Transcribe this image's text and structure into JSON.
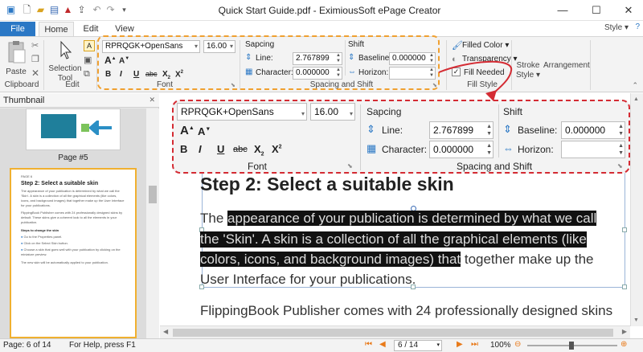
{
  "window": {
    "title": "Quick Start Guide.pdf - EximiousSoft ePage Creator",
    "minimize": "—",
    "maximize": "☐",
    "close": "✕"
  },
  "quick_access": [
    "new-icon",
    "open-icon",
    "save-icon",
    "pdf-icon",
    "export-icon",
    "undo-icon",
    "redo-icon",
    "dropdown-icon"
  ],
  "tabs": {
    "file": "File",
    "home": "Home",
    "edit": "Edit",
    "view": "View",
    "style_menu": "Style ▾"
  },
  "ribbon": {
    "clipboard": {
      "paste": "Paste",
      "label": "Clipboard"
    },
    "edit": {
      "selection_tool_line1": "Selection",
      "selection_tool_line2": "Tool",
      "label": "Edit"
    },
    "font": {
      "family": "RPRQGK+OpenSans",
      "size": "16.00",
      "label": "Font"
    },
    "spacing": {
      "header": "Sapcing",
      "line_label": "Line:",
      "line_value": "2.767899",
      "character_label": "Character:",
      "character_value": "0.000000",
      "label": "Spacing and Shift"
    },
    "shift": {
      "header": "Shift",
      "baseline_label": "Baseline:",
      "baseline_value": "0.000000",
      "horizon_label": "Horizon:",
      "horizon_value": ""
    },
    "fill_style": {
      "filled_color": "Filled Color ▾",
      "transparency": "Transparency ▾",
      "fill_needed": "Fill Needed",
      "label": "Fill Style"
    },
    "stroke_style": {
      "line1": "Stroke",
      "line2": "Style ▾"
    },
    "arrangement": "Arrangement"
  },
  "thumbnail": {
    "header": "Thumbnail",
    "page5_label": "Page #5",
    "page6": {
      "page_no": "PAGE 6",
      "heading": "Step 2: Select a suitable skin",
      "para1": "The appearance of your publication is determined by what we call the 'Skin'. A skin is a collection of all the graphical elements (like colors, icons, and background images) that together make up the User Interface for your publications.",
      "para2": "FlippingBook Publisher comes with 24 professionally designed skins by default. These skins give a coherent look to all the elements in your publication.",
      "steps_title": "Steps to change the skin",
      "step1": "Go to the Properties panel.",
      "step2": "Click on the Select Skin button.",
      "step3": "Choose a skin that goes well with your publication by clicking on the miniature preview.",
      "footer": "The new skin will be automatically applied to your publication."
    }
  },
  "zoom_panel": {
    "font_family": "RPRQGK+OpenSans",
    "font_size": "16.00",
    "font_label": "Font",
    "spacing_header": "Sapcing",
    "line_label": "Line:",
    "line_value": "2.767899",
    "character_label": "Character:",
    "character_value": "0.000000",
    "shift_header": "Shift",
    "baseline_label": "Baseline:",
    "baseline_value": "0.000000",
    "horizon_label": "Horizon:",
    "horizon_value": "",
    "group_label": "Spacing and Shift"
  },
  "document": {
    "heading": "Step 2: Select a suitable skin",
    "line1_plain": "The ",
    "line1_hl": " appearance of your publication is determined by what we call",
    "line2": "the 'Skin'. A skin is a collection of all the graphical elements (like",
    "line3_hl": "colors, icons, and background images) that",
    "line3_plain": " together make up the",
    "line4": "User Interface for your publications.",
    "line5": "FlippingBook  Publisher comes with 24 professionally designed skins"
  },
  "status": {
    "page": "Page: 6 of 14",
    "help": "For Help, press F1",
    "page_input": "6 / 14",
    "zoom": "100%"
  },
  "colors": {
    "accent": "#2b78c5",
    "orange_highlight": "#f0a030",
    "red_highlight": "#d42b33",
    "selected_text_bg": "#111111"
  }
}
